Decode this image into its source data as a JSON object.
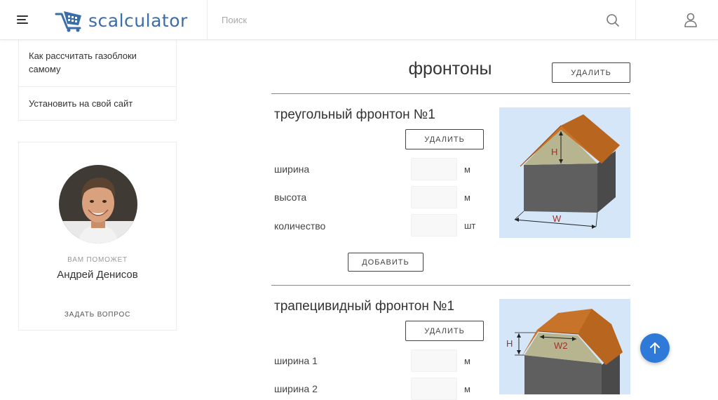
{
  "header": {
    "logo_text": "scalculator",
    "search_placeholder": "Поиск"
  },
  "sidebar": {
    "links": [
      {
        "label": "Как рассчитать газоблоки самому"
      },
      {
        "label": "Установить на свой сайт"
      }
    ],
    "helper": {
      "label": "ВАМ ПОМОЖЕТ",
      "name": "Андрей Денисов",
      "ask": "ЗАДАТЬ ВОПРОС"
    }
  },
  "main": {
    "title": "фронтоны",
    "delete_all_label": "УДАЛИТЬ",
    "sections": [
      {
        "title": "треугольный фронтон №1",
        "delete_label": "УДАЛИТЬ",
        "fields": [
          {
            "label": "ширина",
            "unit": "м",
            "value": ""
          },
          {
            "label": "высота",
            "unit": "м",
            "value": ""
          },
          {
            "label": "количество",
            "unit": "шт",
            "value": ""
          }
        ],
        "add_label": "ДОБАВИТЬ",
        "diagram": {
          "h_label": "H",
          "w_label": "W"
        }
      },
      {
        "title": "трапецивидный фронтон №1",
        "delete_label": "УДАЛИТЬ",
        "fields": [
          {
            "label": "ширина 1",
            "unit": "м",
            "value": ""
          },
          {
            "label": "ширина 2",
            "unit": "м",
            "value": ""
          }
        ],
        "diagram": {
          "h_label": "H",
          "w2_label": "W2"
        }
      }
    ]
  },
  "colors": {
    "brand": "#3b6ea8",
    "accent_button": "#2f7ad8",
    "roof": "#c8732a",
    "wall": "#5f5f5f",
    "gable": "#b7b58f",
    "diagram_bg": "#d5e6f8"
  }
}
